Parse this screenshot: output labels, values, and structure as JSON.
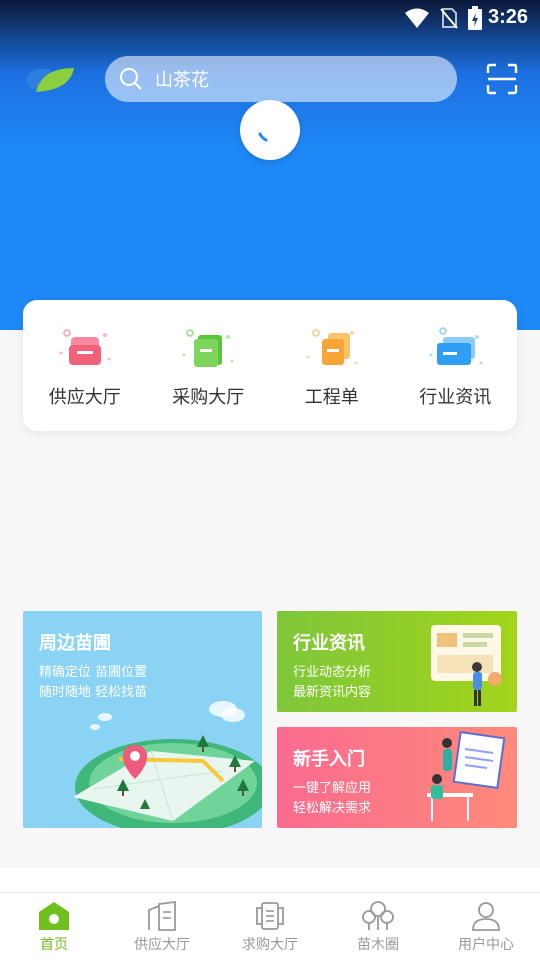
{
  "status": {
    "time": "3:26"
  },
  "header": {
    "search_value": "山茶花"
  },
  "categories": [
    {
      "label": "供应大厅",
      "icon": "supply-hall-icon",
      "color": "#f3607a"
    },
    {
      "label": "采购大厅",
      "icon": "purchase-hall-icon",
      "color": "#5bc53a"
    },
    {
      "label": "工程单",
      "icon": "project-order-icon",
      "color": "#f7a534"
    },
    {
      "label": "行业资讯",
      "icon": "industry-news-icon",
      "color": "#2f9ff5"
    }
  ],
  "tiles": {
    "nearby": {
      "title": "周边苗圃",
      "line1": "精确定位 苗圃位置",
      "line2": "随时随地 轻松找苗"
    },
    "news": {
      "title": "行业资讯",
      "line1": "行业动态分析",
      "line2": "最新资讯内容"
    },
    "guide": {
      "title": "新手入门",
      "line1": "一键了解应用",
      "line2": "轻松解决需求"
    }
  },
  "tabbar": [
    {
      "label": "首页",
      "active": true
    },
    {
      "label": "供应大厅",
      "active": false
    },
    {
      "label": "求购大厅",
      "active": false
    },
    {
      "label": "苗木圈",
      "active": false
    },
    {
      "label": "用户中心",
      "active": false
    }
  ],
  "colors": {
    "brand_blue": "#1e88f7",
    "active_green": "#6fbf1f"
  }
}
